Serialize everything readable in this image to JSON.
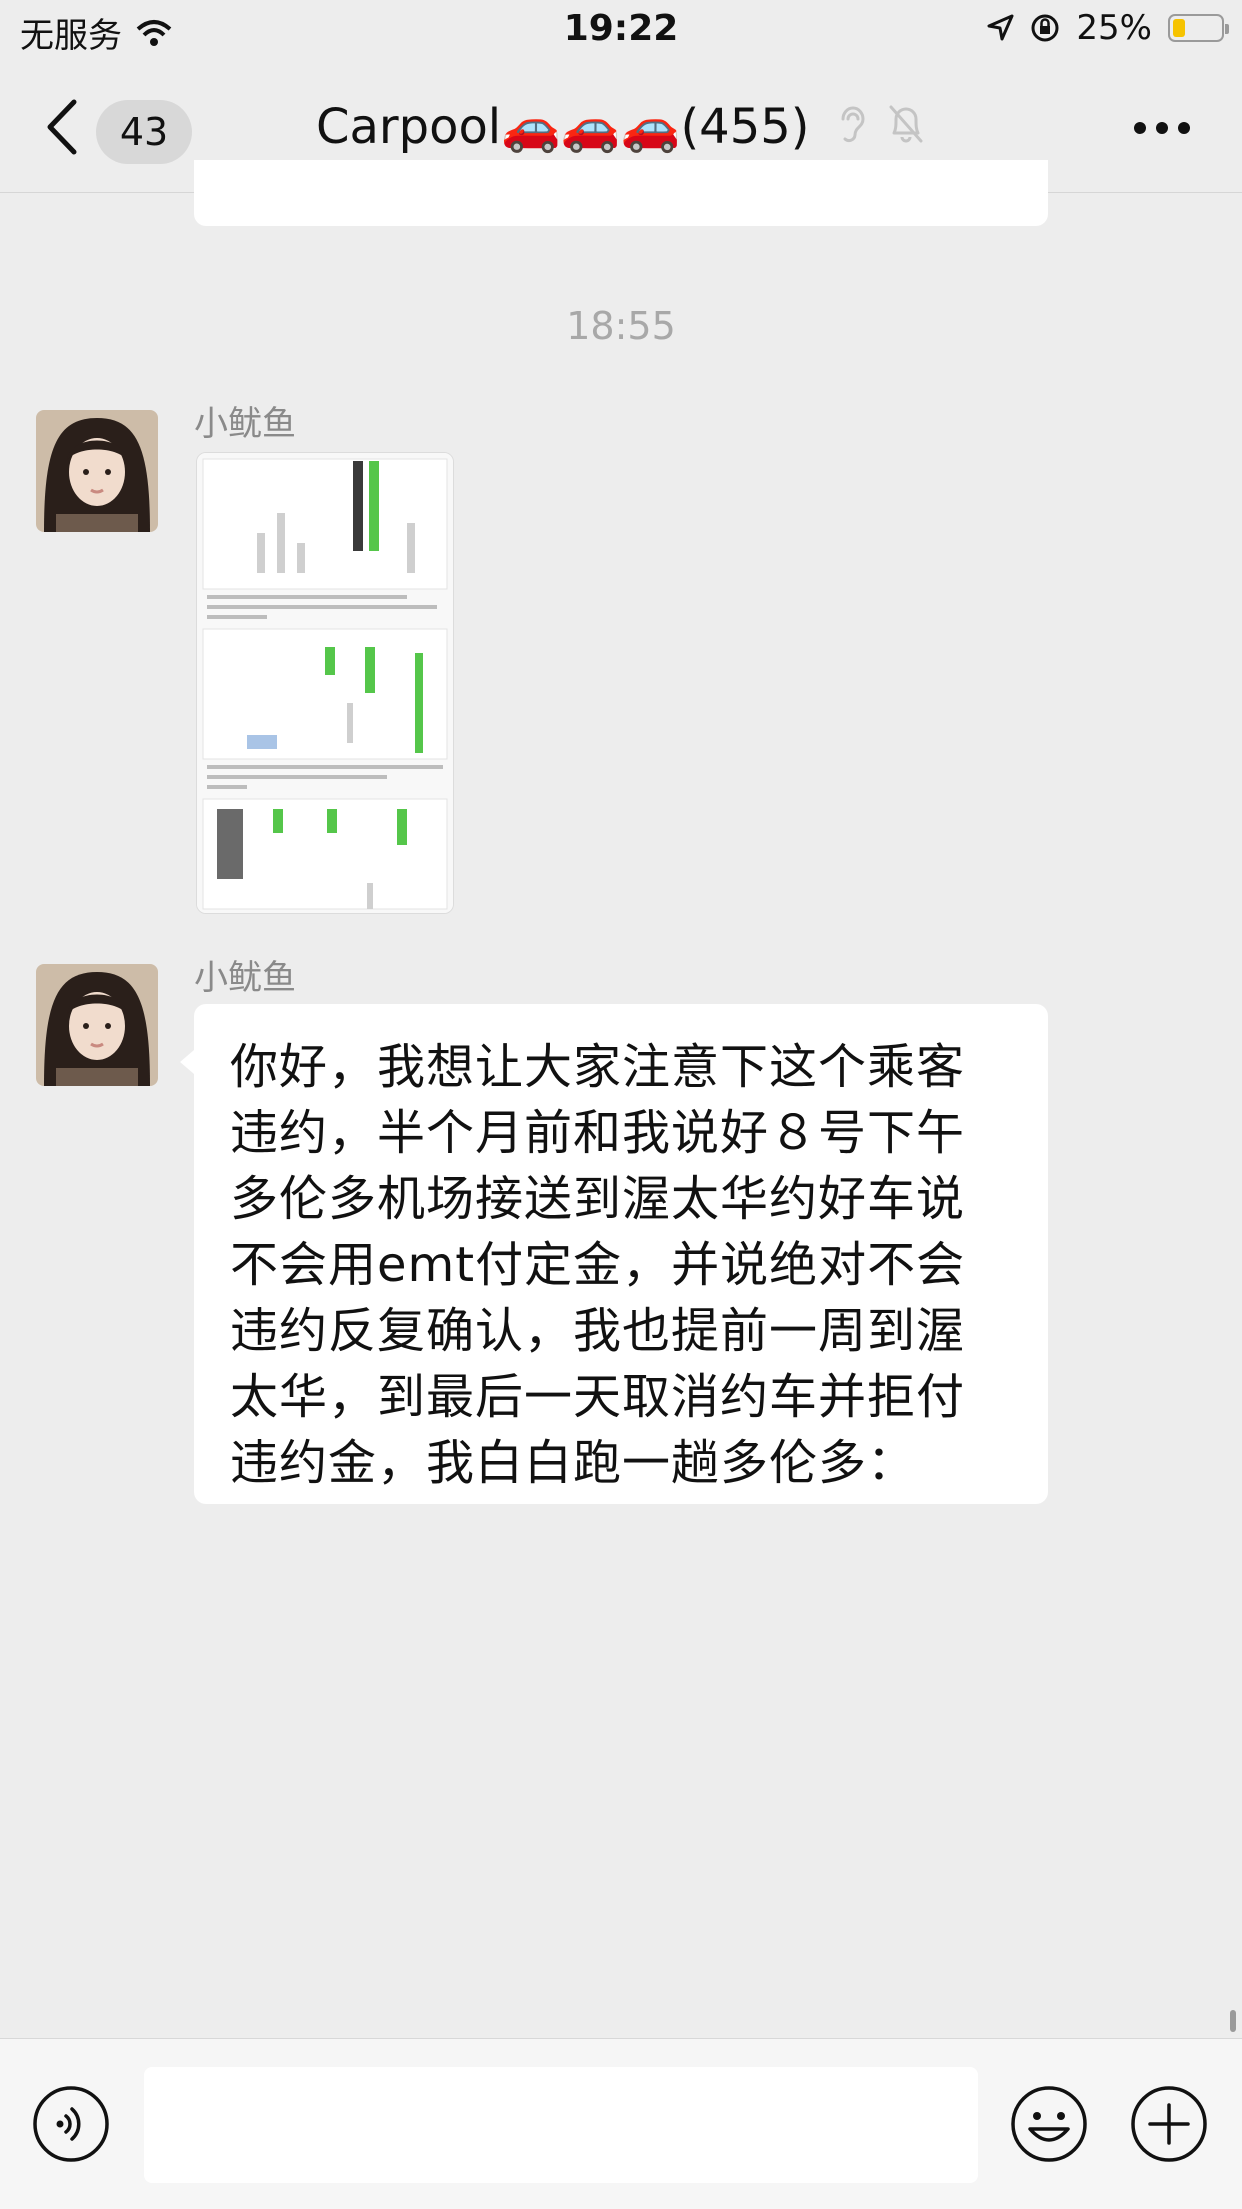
{
  "status_bar": {
    "carrier": "无服务",
    "time": "19:22",
    "battery_percent": "25%",
    "battery_level": 0.25,
    "battery_color": "#f6c300"
  },
  "nav": {
    "back_icon": "chevron-left-icon",
    "unread_count": "43",
    "title": "Carpool🚗🚗🚗(455)",
    "icons": [
      "ear-icon",
      "bell-muted-icon",
      "more-dots-icon"
    ]
  },
  "chat": {
    "time_divider": "18:55",
    "messages": [
      {
        "sender": "小鱿鱼",
        "type": "image"
      },
      {
        "sender": "小鱿鱼",
        "type": "text",
        "text": "你好，我想让大家注意下这个乘客\n违约，半个月前和我说好８号下午\n多伦多机场接送到渥太华约好车说\n不会用emt付定金，并说绝对不会\n违约反复确认，我也提前一周到渥\n太华，到最后一天取消约车并拒付\n违约金，我白白跑一趟多伦多："
      }
    ]
  },
  "input_bar": {
    "placeholder": "",
    "icons": [
      "voice-icon",
      "emoji-icon",
      "plus-icon"
    ]
  }
}
